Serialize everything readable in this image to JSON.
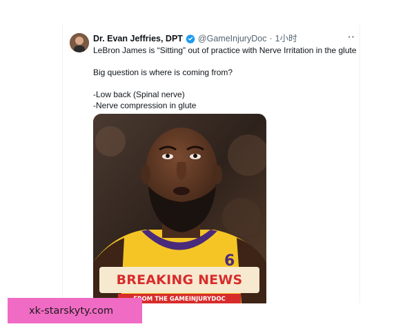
{
  "tweet": {
    "author": {
      "display_name": "Dr. Evan Jeffries, DPT",
      "handle": "@GameInjuryDoc",
      "separator": "·",
      "time": "1小时",
      "verified": true
    },
    "text_lines": [
      "LeBron James is “Sitting” out of practice with Nerve Irritation in the glute",
      "",
      "Big question is where is coming from?",
      "",
      "-Low back (Spinal nerve)",
      "-Nerve compression in glute"
    ],
    "media": {
      "banner_title": "BREAKING NEWS",
      "banner_subtitle": "FROM THE GAMEINJURYDOC",
      "jersey_number": "6"
    }
  },
  "watermark": {
    "text": "xk-starskyty.com"
  },
  "colors": {
    "verified_blue": "#1d9bf0",
    "banner_red": "#d82c2c",
    "banner_cream": "#f6e9cf",
    "jersey_gold": "#f5c526",
    "jersey_purple": "#4a2a7a",
    "watermark_pink": "#f06bc4"
  }
}
